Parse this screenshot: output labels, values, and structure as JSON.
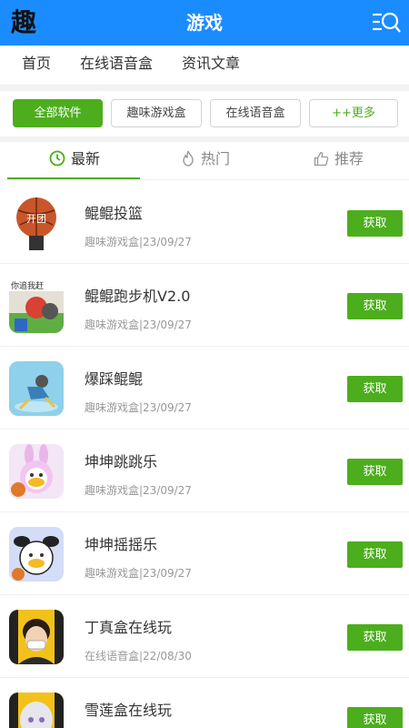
{
  "header": {
    "logo_text": "趣",
    "title": "游戏"
  },
  "topnav": {
    "items": [
      "首页",
      "在线语音盒",
      "资讯文章"
    ]
  },
  "filters": {
    "items": [
      "全部软件",
      "趣味游戏盒",
      "在线语音盒",
      "++更多"
    ]
  },
  "tabs": {
    "items": [
      "最新",
      "热门",
      "推荐"
    ]
  },
  "list": {
    "button_label": "获取",
    "items": [
      {
        "name": "鲲鲲投篮",
        "meta": "趣味游戏盒|23/09/27",
        "thumb_text": "开团"
      },
      {
        "name": "鲲鲲跑步机V2.0",
        "meta": "趣味游戏盒|23/09/27",
        "thumb_text": "你追我赶"
      },
      {
        "name": "爆踩鲲鲲",
        "meta": "趣味游戏盒|23/09/27",
        "thumb_text": ""
      },
      {
        "name": "坤坤跳跳乐",
        "meta": "趣味游戏盒|23/09/27",
        "thumb_text": ""
      },
      {
        "name": "坤坤摇摇乐",
        "meta": "趣味游戏盒|23/09/27",
        "thumb_text": ""
      },
      {
        "name": "丁真盒在线玩",
        "meta": "在线语音盒|22/08/30",
        "thumb_text": ""
      },
      {
        "name": "雪莲盒在线玩",
        "meta": "",
        "thumb_text": ""
      }
    ]
  },
  "colors": {
    "header_bg": "#1a8cff",
    "accent_green": "#4cae1c"
  }
}
